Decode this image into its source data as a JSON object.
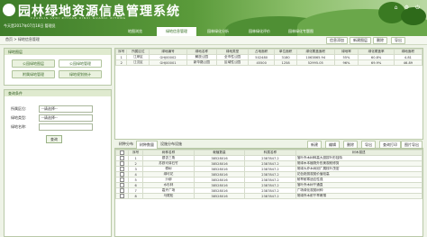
{
  "app": {
    "title": "园林绿地资源信息管理系统",
    "subtitle": "YUANLIN LVDI ZIYUAN XINXI GUANLI XITONG",
    "user_line": "今天是2017年07月18日  管理员"
  },
  "main_nav": [
    {
      "label": "地图浏览",
      "active": false
    },
    {
      "label": "绿地信息管理",
      "active": true
    },
    {
      "label": "园林绿化分析",
      "active": false
    },
    {
      "label": "园林绿化评价",
      "active": false
    },
    {
      "label": "园林绿化专题图",
      "active": false
    }
  ],
  "breadcrumb": "首页 > 绿地信息管理",
  "toolbar": {
    "btn1": "信息添加",
    "btn2": "新建图层",
    "btn3": "删除",
    "btn4": "导出"
  },
  "left": {
    "layer_title": "绿地图层",
    "layers": [
      {
        "label": "公园绿地图层",
        "selected": false
      },
      {
        "label": "公园绿地管理",
        "selected": true
      },
      {
        "label": "附属绿地管理",
        "selected": false
      },
      {
        "label": "绿地规划统计",
        "selected": false
      }
    ],
    "query_title": "查询条件",
    "query": {
      "district_label": "所属区位:",
      "district_value": "--请选择--",
      "type_label": "绿地类型:",
      "type_value": "--请选择--",
      "name_label": "绿地名称:",
      "search_btn": "查询"
    }
  },
  "top_table": {
    "headers": [
      "序号",
      "所属区位",
      "绿地编号",
      "绿地名称",
      "绿地类型",
      "占地面积",
      "单位面积",
      "绿化覆盖面积",
      "绿地率",
      "绿化覆盖率",
      "绿地面积"
    ],
    "rows": [
      [
        "1",
        "江岸区",
        "GHJ00002",
        "解放公园",
        "全市性公园",
        "502480",
        "3180",
        "1063865.94",
        "55%",
        "60.8%",
        "4.81"
      ],
      [
        "2",
        "江汉区",
        "GHJ00001",
        "新华路公园",
        "区域性公园",
        "45500",
        "1258",
        "52995.05",
        "96%",
        "69.9%",
        "46.89"
      ]
    ]
  },
  "sub_tabs": {
    "tab1": "树种分布",
    "tab2": "树种数量",
    "tab3": "设施分布设施"
  },
  "sub_toolbar": {
    "add": "新建",
    "edit": "编辑",
    "del": "删除",
    "export": "导出",
    "print": "查询打印",
    "more": "图片导出"
  },
  "bottom_table": {
    "headers": [
      "",
      "序号",
      "树种名称",
      "栽植数量",
      "科属名称",
      "树木描述"
    ],
    "rows": [
      [
        "1",
        "银杏三角",
        "38528016",
        "2387847.2",
        "落叶乔木树种高大挺拔叶形独特"
      ],
      [
        "2",
        "苏铁可芽石竹",
        "38528016",
        "2387847.2",
        "常绿木本植物外形美观耐修剪"
      ],
      [
        "3",
        "樟树",
        "38528016",
        "2387847.2",
        "常绿大乔木树冠广展枝叶茂密"
      ],
      [
        "4",
        "绿可花",
        "38528016",
        "2387847.2",
        "花色艳丽观赏价值较高"
      ],
      [
        "5",
        "沙柳",
        "38528016",
        "2387847.2",
        "耐旱耐寒适应性强"
      ],
      [
        "6",
        "水杉林",
        "38528016",
        "2387847.2",
        "落叶乔木树干通直"
      ],
      [
        "7",
        "嘉卉广场",
        "38528016",
        "2387847.2",
        "广场绿化观赏树种"
      ],
      [
        "8",
        "马尾松",
        "38528016",
        "2387847.2",
        "常绿乔木耐干旱瘠薄"
      ]
    ]
  }
}
